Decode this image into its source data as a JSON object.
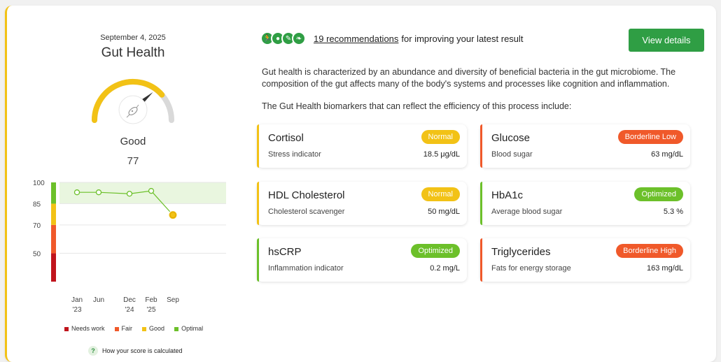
{
  "left": {
    "date": "September 4, 2025",
    "title": "Gut Health",
    "status": "Good",
    "score": "77",
    "gauge": {
      "value": 77,
      "max": 100,
      "color": "#f2c216",
      "icon": "bacteria-icon"
    },
    "legend": [
      {
        "label": "Needs work",
        "color": "#c0141c"
      },
      {
        "label": "Fair",
        "color": "#f0592a"
      },
      {
        "label": "Good",
        "color": "#f2c216"
      },
      {
        "label": "Optimal",
        "color": "#6cc02a"
      }
    ],
    "how_calc": "How your score is calculated",
    "help_icon": "?"
  },
  "chart_data": {
    "type": "line",
    "y_ticks": [
      "100",
      "85",
      "70",
      "50"
    ],
    "x_labels": [
      {
        "top": "Jan",
        "bottom": "'23"
      },
      {
        "top": "Jun",
        "bottom": ""
      },
      {
        "top": "Dec",
        "bottom": "'24"
      },
      {
        "top": "Feb",
        "bottom": "'25"
      },
      {
        "top": "Sep",
        "bottom": ""
      }
    ],
    "points": [
      {
        "x": "Jan '23",
        "y": 93
      },
      {
        "x": "Jun",
        "y": 93
      },
      {
        "x": "Dec '24",
        "y": 92
      },
      {
        "x": "Feb '25",
        "y": 94
      },
      {
        "x": "Sep",
        "y": 77
      }
    ],
    "ylim": [
      30,
      100
    ],
    "optimal_band": [
      85,
      100
    ],
    "zones": [
      {
        "from": 30,
        "to": 50,
        "color": "#c0141c"
      },
      {
        "from": 50,
        "to": 70,
        "color": "#f0592a"
      },
      {
        "from": 70,
        "to": 85,
        "color": "#f2c216"
      },
      {
        "from": 85,
        "to": 100,
        "color": "#6cc02a"
      }
    ],
    "line_color": "#6cc02a",
    "latest_color": "#f2c216"
  },
  "recommendations": {
    "icons": [
      "running-icon",
      "apple-icon",
      "pill-icon",
      "leaf-icon"
    ],
    "link": "19 recommendations",
    "text": "for improving your latest result",
    "button": "View details"
  },
  "description": "Gut health is characterized by an abundance and diversity of beneficial bacteria in the gut microbiome. The composition of the gut affects many of the body's systems and processes like cognition and inflammation.",
  "biomarkers_intro": "The Gut Health biomarkers that can reflect the efficiency of this process include:",
  "biomarkers": [
    {
      "name": "Cortisol",
      "sub": "Stress indicator",
      "value": "18.5 μg/dL",
      "badge": "Normal",
      "color": "#f2c216"
    },
    {
      "name": "Glucose",
      "sub": "Blood sugar",
      "value": "63 mg/dL",
      "badge": "Borderline Low",
      "color": "#f0592a"
    },
    {
      "name": "HDL Cholesterol",
      "sub": "Cholesterol scavenger",
      "value": "50 mg/dL",
      "badge": "Normal",
      "color": "#f2c216"
    },
    {
      "name": "HbA1c",
      "sub": "Average blood sugar",
      "value": "5.3 %",
      "badge": "Optimized",
      "color": "#6cc02a"
    },
    {
      "name": "hsCRP",
      "sub": "Inflammation indicator",
      "value": "0.2 mg/L",
      "badge": "Optimized",
      "color": "#6cc02a"
    },
    {
      "name": "Triglycerides",
      "sub": "Fats for energy storage",
      "value": "163 mg/dL",
      "badge": "Borderline High",
      "color": "#f0592a"
    }
  ]
}
